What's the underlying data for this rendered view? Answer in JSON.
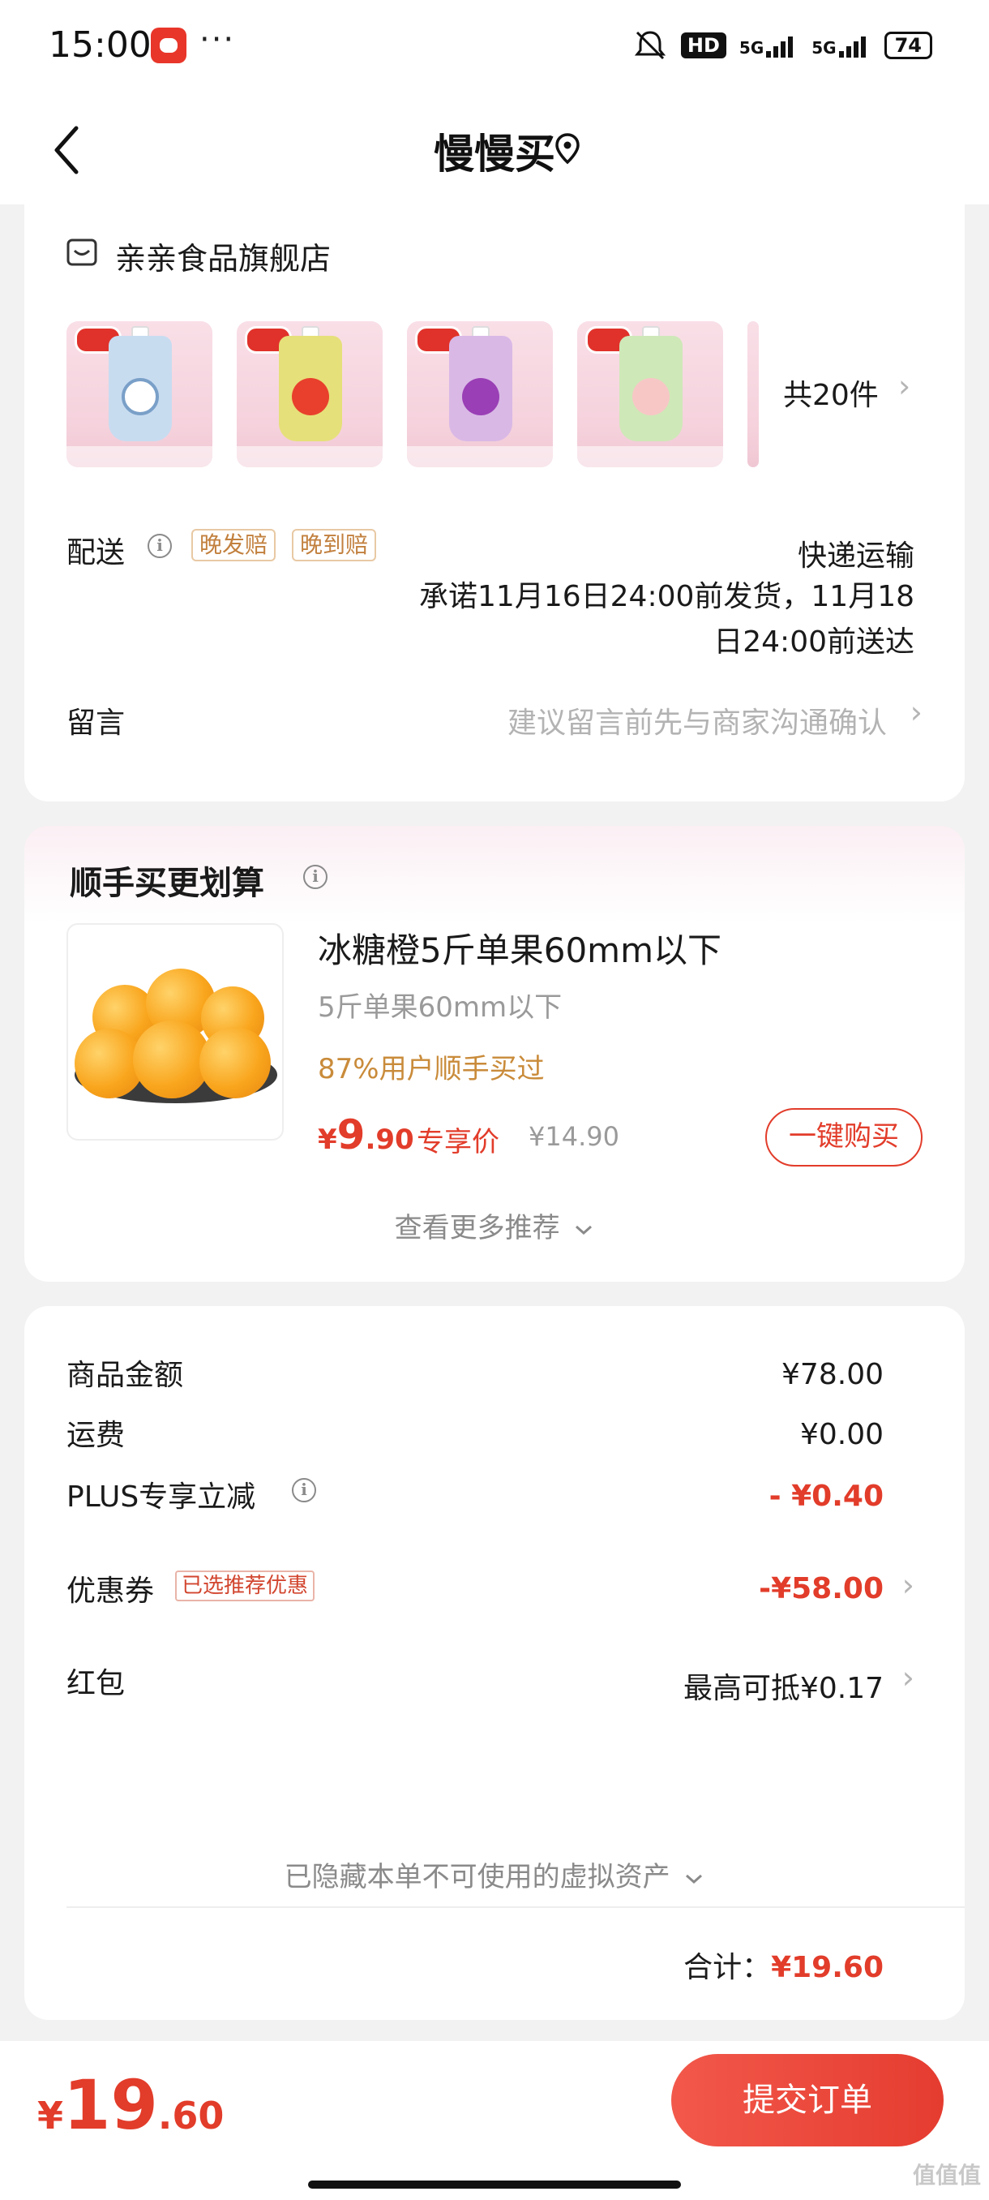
{
  "status_bar": {
    "time": "15:00",
    "dots": "···",
    "network_1": "HD",
    "network_2": "5G",
    "network_3": "5G",
    "battery": "74"
  },
  "nav": {
    "title": "慢慢买"
  },
  "store": {
    "name": "亲亲食品旗舰店",
    "total_count": "共20件"
  },
  "delivery": {
    "label": "配送",
    "tags": [
      "晚发赔",
      "晚到赔"
    ],
    "method": "快递运输",
    "promise_line1": "承诺11月16日24:00前发货，11月18",
    "promise_line2": "日24:00前送达"
  },
  "note": {
    "label": "留言",
    "placeholder": "建议留言前先与商家沟通确认"
  },
  "recommend": {
    "title": "顺手买更划算",
    "product_name": "冰糖橙5斤单果60mm以下",
    "spec": "5斤单果60mm以下",
    "social_proof": "87%用户顺手买过",
    "price_symbol": "¥",
    "price_int": "9",
    "price_dec": ".90",
    "exclusive_label": "专享价",
    "original_price": "¥14.90",
    "buy_button": "一键购买",
    "more_label": "查看更多推荐"
  },
  "summary": {
    "rows": [
      {
        "label": "商品金额",
        "value": "¥78.00"
      },
      {
        "label": "运费",
        "value": "¥0.00"
      },
      {
        "label": "PLUS专享立减",
        "value": "- ¥0.40"
      },
      {
        "label": "优惠券",
        "tag": "已选推荐优惠",
        "value": "-¥58.00"
      },
      {
        "label": "红包",
        "value": "最高可抵¥0.17"
      }
    ],
    "hidden_assets": "已隐藏本单不可使用的虚拟资产",
    "total_label": "合计：",
    "total_value": "¥19.60"
  },
  "bottom": {
    "price_symbol": "¥",
    "price_int": "19",
    "price_dec": ".60",
    "submit_label": "提交订单",
    "watermark": "值值值"
  },
  "colors": {
    "accent_red": "#e23c2a",
    "tag_gold": "#c2803e",
    "page_bg": "#f2f2f2"
  }
}
